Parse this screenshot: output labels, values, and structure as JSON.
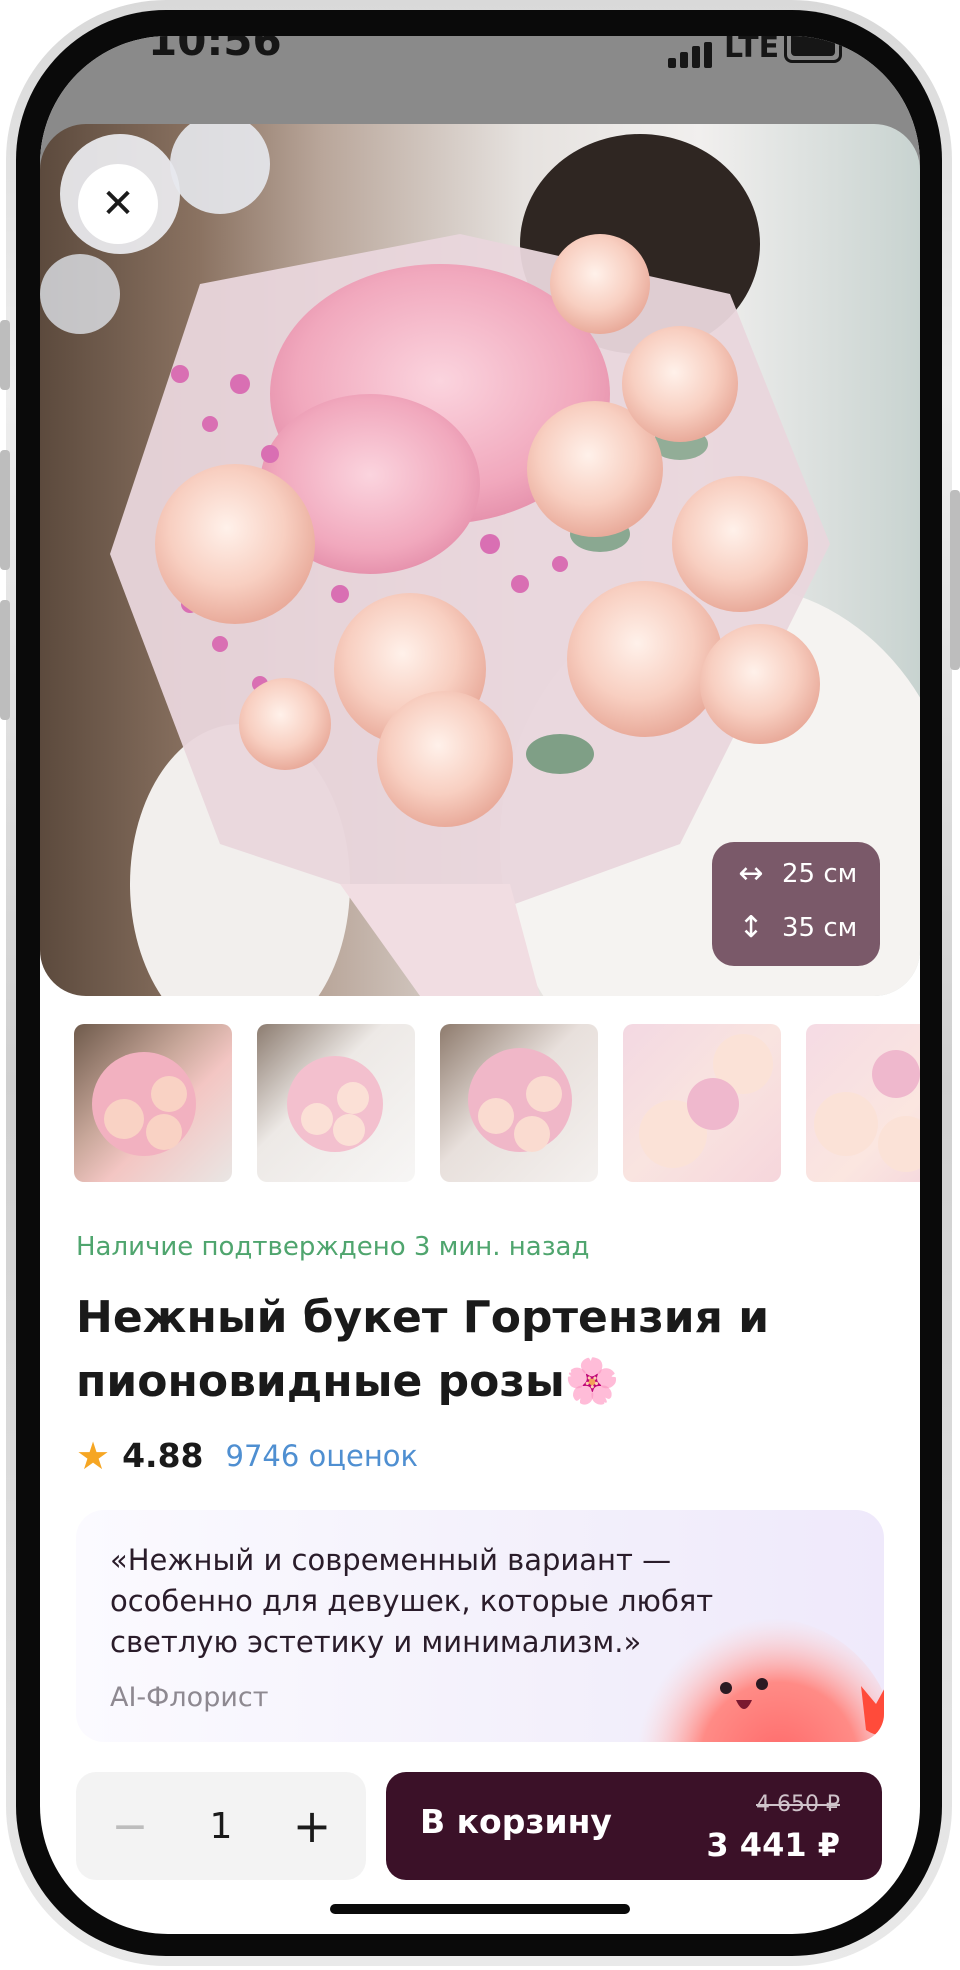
{
  "status_bar": {
    "time": "10:56",
    "network": "LTE"
  },
  "hero": {
    "close_icon": "close-icon",
    "size_badge": {
      "width": "25 см",
      "height": "35 см"
    }
  },
  "thumbnails": [
    "photo-1",
    "photo-2",
    "photo-3",
    "photo-4",
    "photo-5"
  ],
  "product": {
    "availability": "Наличие подтверждено 3 мин. назад",
    "title": "Нежный букет Гортензия и пионовидные розы🌸",
    "rating": "4.88",
    "reviews": "9746 оценок"
  },
  "ai_florist": {
    "quote": "«Нежный и современный вариант — особенно для девушек, которые любят светлую эстетику и минимализм.»",
    "author": "AI-Флорист"
  },
  "cart": {
    "quantity": "1",
    "minus": "−",
    "plus": "+",
    "button_label": "В корзину",
    "old_price": "4 650 ₽",
    "price": "3 441 ₽"
  },
  "colors": {
    "availability_green": "#4fa56e",
    "link_blue": "#4f8fd1",
    "cart_button": "#3b1128",
    "star": "#f6a623"
  }
}
